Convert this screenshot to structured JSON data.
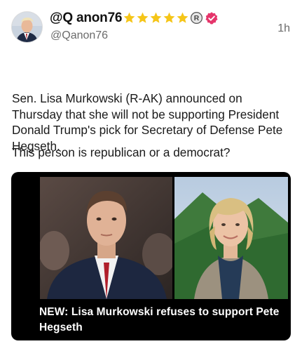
{
  "post": {
    "display_name": "@Q anon76",
    "handle": "@Qanon76",
    "time": "1h",
    "body": "Sen. Lisa Murkowski (R-AK) announced on Thursday that she will not be supporting President Donald Trump's pick for Secretary of Defense Pete Hegseth.",
    "question": "This person is republican or a democrat?",
    "badges": [
      "star-icon",
      "star-icon",
      "star-icon",
      "star-icon",
      "star-icon",
      "registered-icon",
      "verified-icon"
    ]
  },
  "media": {
    "caption": "NEW: Lisa Murkowski refuses to support Pete Hegseth"
  },
  "colors": {
    "star": "#f5c518",
    "verified": "#e5356b",
    "secondary_text": "#6b6b6b"
  }
}
